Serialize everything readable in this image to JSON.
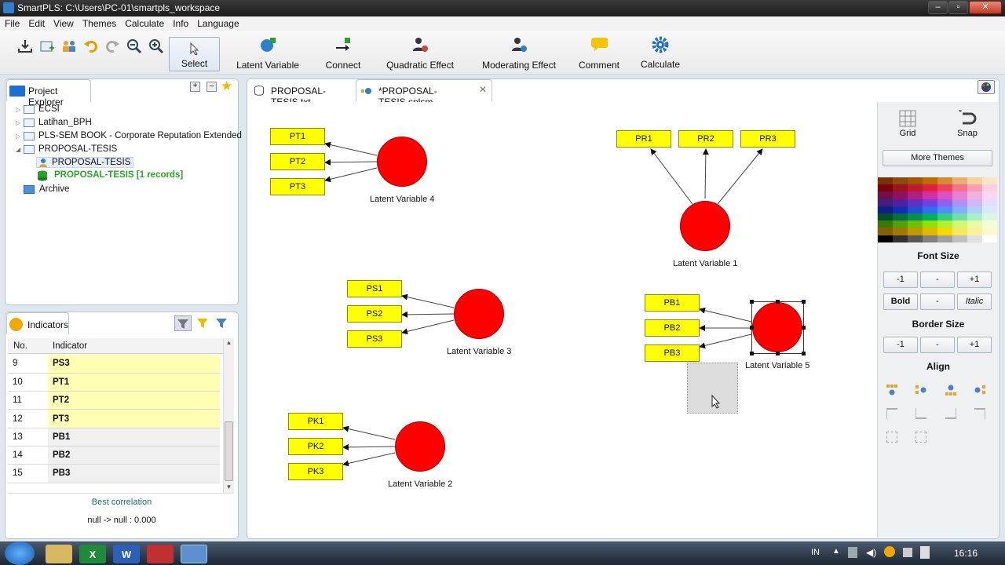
{
  "window": {
    "title": "SmartPLS: C:\\Users\\PC-01\\smartpls_workspace"
  },
  "menu": [
    "File",
    "Edit",
    "View",
    "Themes",
    "Calculate",
    "Info",
    "Language"
  ],
  "toolbar": {
    "select": "Select",
    "latent_variable": "Latent Variable",
    "connect": "Connect",
    "quadratic_effect": "Quadratic Effect",
    "moderating_effect": "Moderating Effect",
    "comment": "Comment",
    "calculate": "Calculate"
  },
  "project_explorer": {
    "tab": "Project Explorer",
    "items": [
      "ECSI",
      "Latihan_BPH",
      "PLS-SEM BOOK - Corporate Reputation Extended",
      "PROPOSAL-TESIS",
      "PROPOSAL-TESIS",
      "PROPOSAL-TESIS [1 records]",
      "Archive"
    ]
  },
  "indicators": {
    "tab": "Indicators",
    "col_no": "No.",
    "col_indicator": "Indicator",
    "rows": [
      {
        "no": "9",
        "name": "PS3",
        "highlight": true
      },
      {
        "no": "10",
        "name": "PT1",
        "highlight": true
      },
      {
        "no": "11",
        "name": "PT2",
        "highlight": true
      },
      {
        "no": "12",
        "name": "PT3",
        "highlight": true
      },
      {
        "no": "13",
        "name": "PB1",
        "highlight": false
      },
      {
        "no": "14",
        "name": "PB2",
        "highlight": false
      },
      {
        "no": "15",
        "name": "PB3",
        "highlight": false
      }
    ],
    "best_corr_label": "Best correlation",
    "best_corr_value": "null -> null : 0.000"
  },
  "editor_tabs": [
    "PROPOSAL-TESIS.txt",
    "*PROPOSAL-TESIS.splsm"
  ],
  "canvas": {
    "latent_variables": [
      "Latent Variable 4",
      "Latent Variable 1",
      "Latent Variable 3",
      "Latent Variable 5",
      "Latent Variable 2"
    ],
    "lv4_indicators": [
      "PT1",
      "PT2",
      "PT3"
    ],
    "lv1_indicators": [
      "PR1",
      "PR2",
      "PR3"
    ],
    "lv3_indicators": [
      "PS1",
      "PS2",
      "PS3"
    ],
    "lv5_indicators": [
      "PB1",
      "PB2",
      "PB3"
    ],
    "lv2_indicators": [
      "PK1",
      "PK2",
      "PK3"
    ]
  },
  "style_panel": {
    "grid": "Grid",
    "snap": "Snap",
    "more_themes": "More Themes",
    "font_size": "Font Size",
    "border_size": "Border Size",
    "align": "Align",
    "minus1": "-1",
    "dash": "-",
    "plus1": "+1",
    "bold": "Bold",
    "italic": "Italic"
  },
  "tray": {
    "lang": "IN",
    "time": "16:16"
  },
  "colors": {
    "latent": "#ff0000",
    "indicator": "#ffff00",
    "indicator_row": "#ffffb3"
  }
}
